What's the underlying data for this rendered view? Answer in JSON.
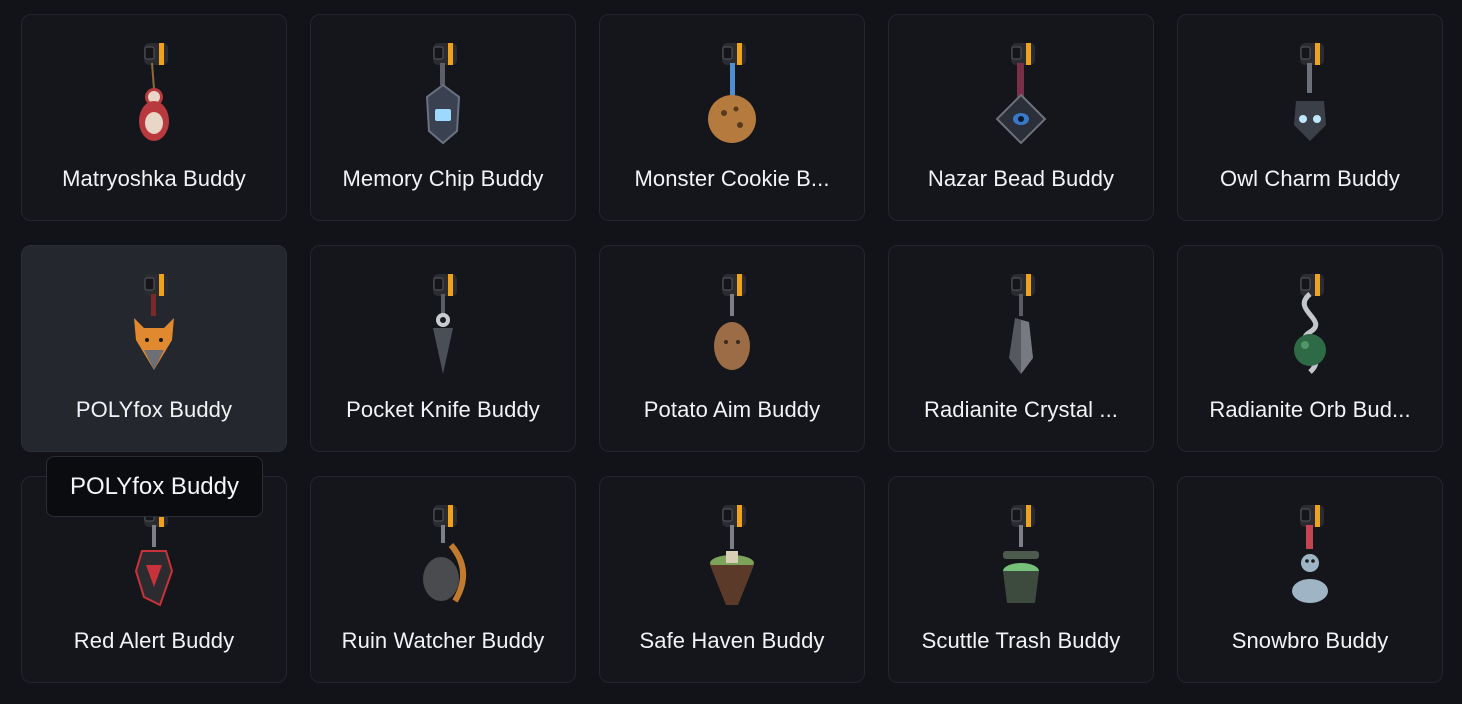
{
  "buddies": [
    {
      "name": "Matryoshka Buddy",
      "icon": "matryoshka-doll-icon",
      "colors": {
        "main": "#b83a3f",
        "accent": "#e8d6c6"
      }
    },
    {
      "name": "Memory Chip Buddy",
      "icon": "memory-chip-icon",
      "colors": {
        "main": "#3a4252",
        "accent": "#9fd8ff"
      }
    },
    {
      "name": "Monster Cookie B...",
      "icon": "cookie-icon",
      "colors": {
        "main": "#b57a3e",
        "accent": "#4f8fd1"
      }
    },
    {
      "name": "Nazar Bead Buddy",
      "icon": "nazar-bead-icon",
      "colors": {
        "main": "#2b2f3a",
        "accent": "#3a78c9"
      }
    },
    {
      "name": "Owl Charm Buddy",
      "icon": "owl-charm-icon",
      "colors": {
        "main": "#3b4048",
        "accent": "#bfe8ff"
      }
    },
    {
      "name": "POLYfox Buddy",
      "icon": "polyfox-icon",
      "colors": {
        "main": "#e0892f",
        "accent": "#6d6f74"
      }
    },
    {
      "name": "Pocket Knife Buddy",
      "icon": "pocket-knife-icon",
      "colors": {
        "main": "#4a4e57",
        "accent": "#c9ccd1"
      }
    },
    {
      "name": "Potato Aim Buddy",
      "icon": "potato-icon",
      "colors": {
        "main": "#9b6c46",
        "accent": "#3b2a1e"
      }
    },
    {
      "name": "Radianite Crystal ...",
      "icon": "crystal-icon",
      "colors": {
        "main": "#55595f",
        "accent": "#8d9197"
      }
    },
    {
      "name": "Radianite Orb Bud...",
      "icon": "orb-icon",
      "colors": {
        "main": "#2f6a46",
        "accent": "#c3c7cc"
      }
    },
    {
      "name": "Red Alert Buddy",
      "icon": "red-alert-icon",
      "colors": {
        "main": "#2c2c30",
        "accent": "#c8323a"
      }
    },
    {
      "name": "Ruin Watcher Buddy",
      "icon": "ruin-watcher-icon",
      "colors": {
        "main": "#4a4b4f",
        "accent": "#c27a2e"
      }
    },
    {
      "name": "Safe Haven Buddy",
      "icon": "floating-island-icon",
      "colors": {
        "main": "#5c3a2a",
        "accent": "#7ea35a"
      }
    },
    {
      "name": "Scuttle Trash Buddy",
      "icon": "trash-can-icon",
      "colors": {
        "main": "#3d4a3e",
        "accent": "#76c07a"
      }
    },
    {
      "name": "Snowbro Buddy",
      "icon": "snowman-icon",
      "colors": {
        "main": "#9fb4c4",
        "accent": "#c44550"
      }
    }
  ],
  "hovered_index": 5,
  "tooltip": {
    "text": "POLYfox Buddy"
  },
  "theme": {
    "clip": "#2a2c31",
    "clip_band": "#f0a21c"
  }
}
